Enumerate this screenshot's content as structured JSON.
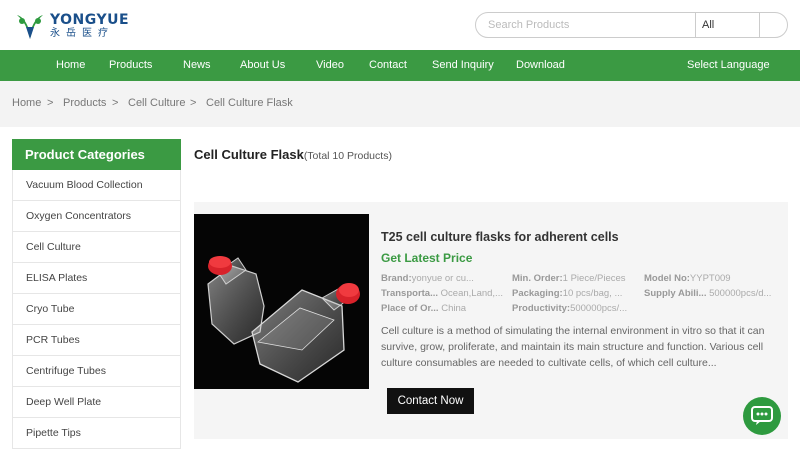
{
  "brand": {
    "name_en": "YONGYUE",
    "name_cn": "永岳医疗"
  },
  "search": {
    "placeholder": "Search Products",
    "category": "All"
  },
  "nav": {
    "items": [
      "Home",
      "Products",
      "News",
      "About Us",
      "Video",
      "Contact",
      "Send Inquiry",
      "Download"
    ],
    "language": "Select Language"
  },
  "breadcrumb": {
    "items": [
      "Home",
      "Products",
      "Cell Culture",
      "Cell Culture Flask"
    ],
    "separator": ">"
  },
  "sidebar": {
    "title": "Product Categories",
    "items": [
      "Vacuum Blood Collection",
      "Oxygen Concentrators",
      "Cell Culture",
      "ELISA Plates",
      "Cryo Tube",
      "PCR Tubes",
      "Centrifuge Tubes",
      "Deep Well Plate",
      "Pipette Tips"
    ]
  },
  "main": {
    "title": "Cell Culture Flask",
    "count": "(Total 10 Products)"
  },
  "product": {
    "name": "T25 cell culture flasks for adherent cells",
    "price_label": "Get Latest Price",
    "specs": [
      {
        "key": "Brand:",
        "value": "yonyue or cu..."
      },
      {
        "key": "Min. Order:",
        "value": "1 Piece/Pieces"
      },
      {
        "key": "Model No:",
        "value": "YYPT009"
      },
      {
        "key": "Transporta...",
        "value": "Ocean,Land,..."
      },
      {
        "key": "Packaging:",
        "value": "10 pcs/bag, ..."
      },
      {
        "key": "Supply Abili...",
        "value": "500000pcs/d..."
      },
      {
        "key": "Place of Or...",
        "value": "China"
      },
      {
        "key": "Productivity:",
        "value": "500000pcs/..."
      }
    ],
    "description": "Cell culture is a method of simulating the internal environment in vitro so that it can survive, grow, proliferate, and maintain its main structure and function. Various cell culture consumables are needed to cultivate cells, of which cell culture...",
    "cta": "Contact Now"
  },
  "colors": {
    "primary_green": "#3b9a43",
    "brand_blue": "#1a4f8a",
    "chat_green": "#2e9a3f"
  }
}
